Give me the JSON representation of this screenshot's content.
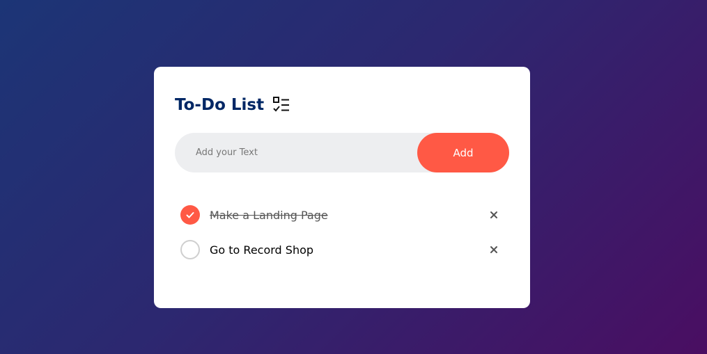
{
  "app": {
    "title": "To-Do List",
    "title_icon": "checklist-icon"
  },
  "input": {
    "placeholder": "Add your Text",
    "value": ""
  },
  "add_button": {
    "label": "Add"
  },
  "tasks": [
    {
      "text": "Make a Landing Page",
      "completed": true
    },
    {
      "text": "Go to Record Shop",
      "completed": false
    }
  ],
  "colors": {
    "accent": "#ff5945",
    "title": "#002765",
    "input_bg": "#edeef0",
    "background_start": "#1c3576",
    "background_end": "#4a0e62"
  }
}
